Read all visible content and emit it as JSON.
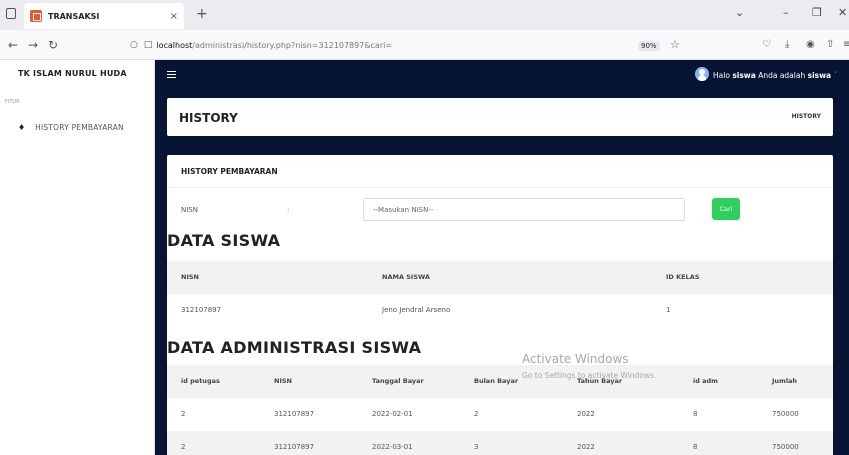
{
  "browser": {
    "tab_title": "TRANSAKSI",
    "tab_close": "×",
    "new_tab": "+",
    "url_host": "localhost",
    "url_path": "/administrasi/history.php?nisn=312107897&cari=",
    "zoom": "90%"
  },
  "sidebar": {
    "brand": "TK ISLAM NURUL HUDA",
    "section": "FITUR",
    "items": [
      {
        "label": "HISTORY PEMBAYARAN"
      }
    ]
  },
  "topbar": {
    "greeting_prefix": "Halo",
    "greeting_user": "siswa",
    "greeting_mid": "Anda adalah",
    "greeting_role": "siswa"
  },
  "header": {
    "title": "HISTORY",
    "breadcrumb": "HISTORY"
  },
  "search": {
    "card_title": "HISTORY PEMBAYARAN",
    "label": "NISN",
    "colon": ":",
    "placeholder": "--Masukan NISN--",
    "button": "Cari"
  },
  "data_siswa": {
    "title": "DATA SISWA",
    "columns": [
      "NISN",
      "NAMA SISWA",
      "ID KELAS"
    ],
    "rows": [
      [
        "312107897",
        "Jeno Jendral Arseno",
        "1"
      ]
    ]
  },
  "data_admin": {
    "title": "DATA ADMINISTRASI SISWA",
    "columns": [
      "id petugas",
      "NISN",
      "Tanggal Bayar",
      "Bulan Bayar",
      "Tahun Bayar",
      "id adm",
      "Jumlah"
    ],
    "rows": [
      [
        "2",
        "312107897",
        "2022-02-01",
        "2",
        "2022",
        "8",
        "750000"
      ],
      [
        "2",
        "312107897",
        "2022-03-01",
        "3",
        "2022",
        "8",
        "750000"
      ]
    ]
  },
  "watermark": {
    "line1": "Activate Windows",
    "line2": "Go to Settings to activate Windows."
  }
}
